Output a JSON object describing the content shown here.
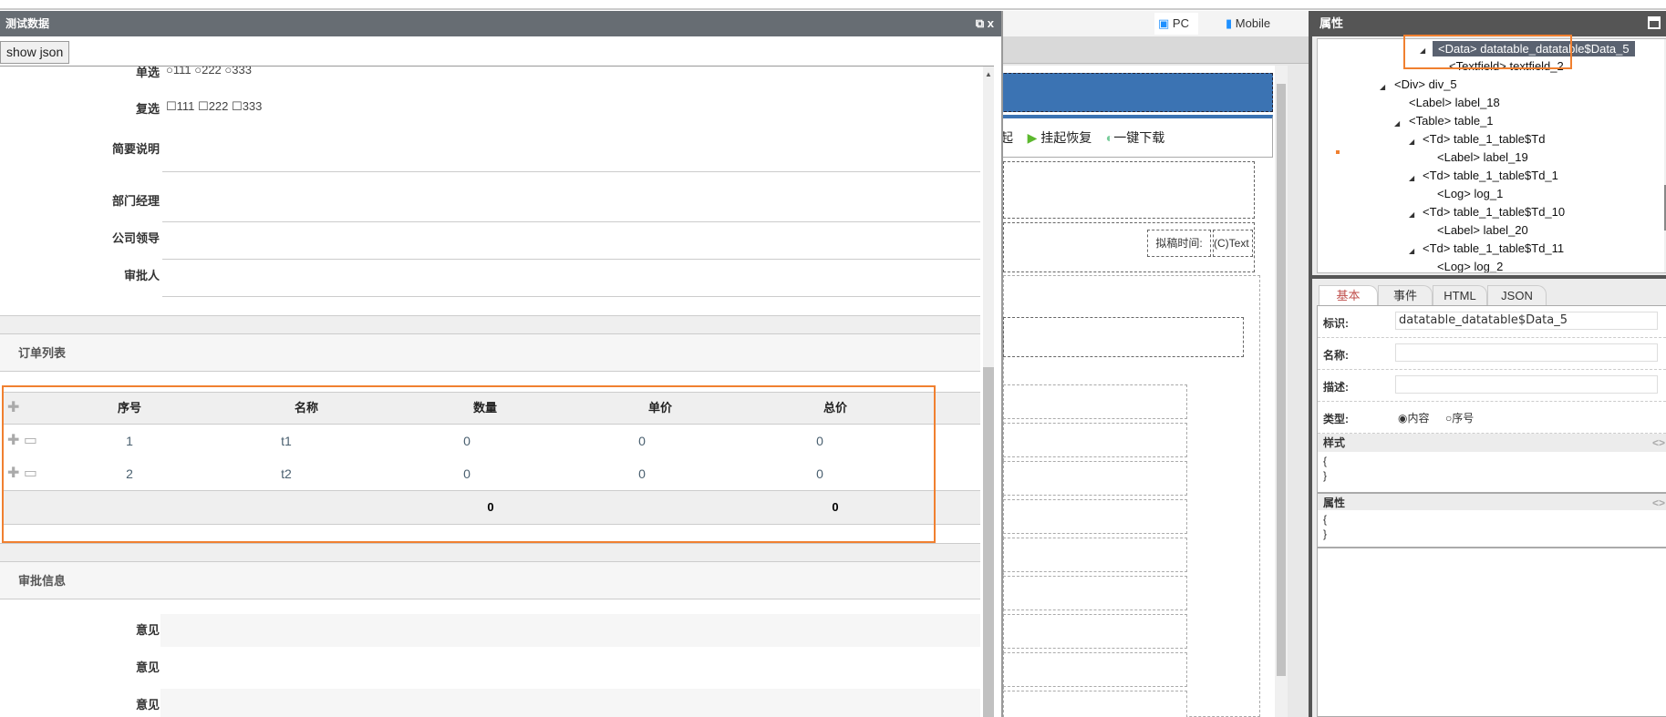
{
  "dialog": {
    "title": "测试数据",
    "controls": "⧉ x",
    "show_json": "show json",
    "fields": [
      {
        "label": "单选",
        "options": [
          "111",
          "222",
          "333"
        ],
        "type": "radio"
      },
      {
        "label": "复选",
        "options": [
          "111",
          "222",
          "333"
        ],
        "type": "checkbox"
      },
      {
        "label": "简要说明"
      },
      {
        "label": "部门经理"
      },
      {
        "label": "公司领导"
      },
      {
        "label": "审批人"
      }
    ],
    "order_section": "订单列表",
    "table": {
      "headers": [
        "序号",
        "名称",
        "数量",
        "单价",
        "总价"
      ],
      "rows": [
        [
          "1",
          "t1",
          "0",
          "0",
          "0"
        ],
        [
          "2",
          "t2",
          "0",
          "0",
          "0"
        ]
      ],
      "footer": {
        "qty_total": "0",
        "total": "0"
      }
    },
    "approval_section": "审批信息",
    "opinions": [
      "意见",
      "意见",
      "意见"
    ]
  },
  "designer": {
    "tabs": [
      "PC",
      "Mobile"
    ],
    "toolbar": {
      "cut": "起",
      "suspend": "挂起恢复",
      "download": "一键下载"
    },
    "draft_time": "拟稿时间:",
    "text_ctrl": "(C)Text"
  },
  "panel": {
    "title": "属性",
    "tree": [
      "<Data> datatable_datatable$Data_5",
      "<Textfield> textfield_2",
      "<Div> div_5",
      "<Label> label_18",
      "<Table> table_1",
      "<Td> table_1_table$Td",
      "<Label> label_19",
      "<Td> table_1_table$Td_1",
      "<Log> log_1",
      "<Td> table_1_table$Td_10",
      "<Label> label_20",
      "<Td> table_1_table$Td_11",
      "<Log> log_2"
    ],
    "tabs": [
      "基本",
      "事件",
      "HTML",
      "JSON"
    ],
    "form": {
      "id_label": "标识:",
      "id_value": "datatable_datatable$Data_5",
      "name_label": "名称:",
      "desc_label": "描述:",
      "type_label": "类型:",
      "type_opts": [
        "内容",
        "序号"
      ],
      "style_label": "样式",
      "attr_label": "属性",
      "brace_open": "{",
      "brace_close": "}",
      "code_toggle": "<>"
    }
  },
  "colors": {
    "accent": "#f08030",
    "header_blue": "#3b73b3",
    "titlebar": "#676d73"
  }
}
